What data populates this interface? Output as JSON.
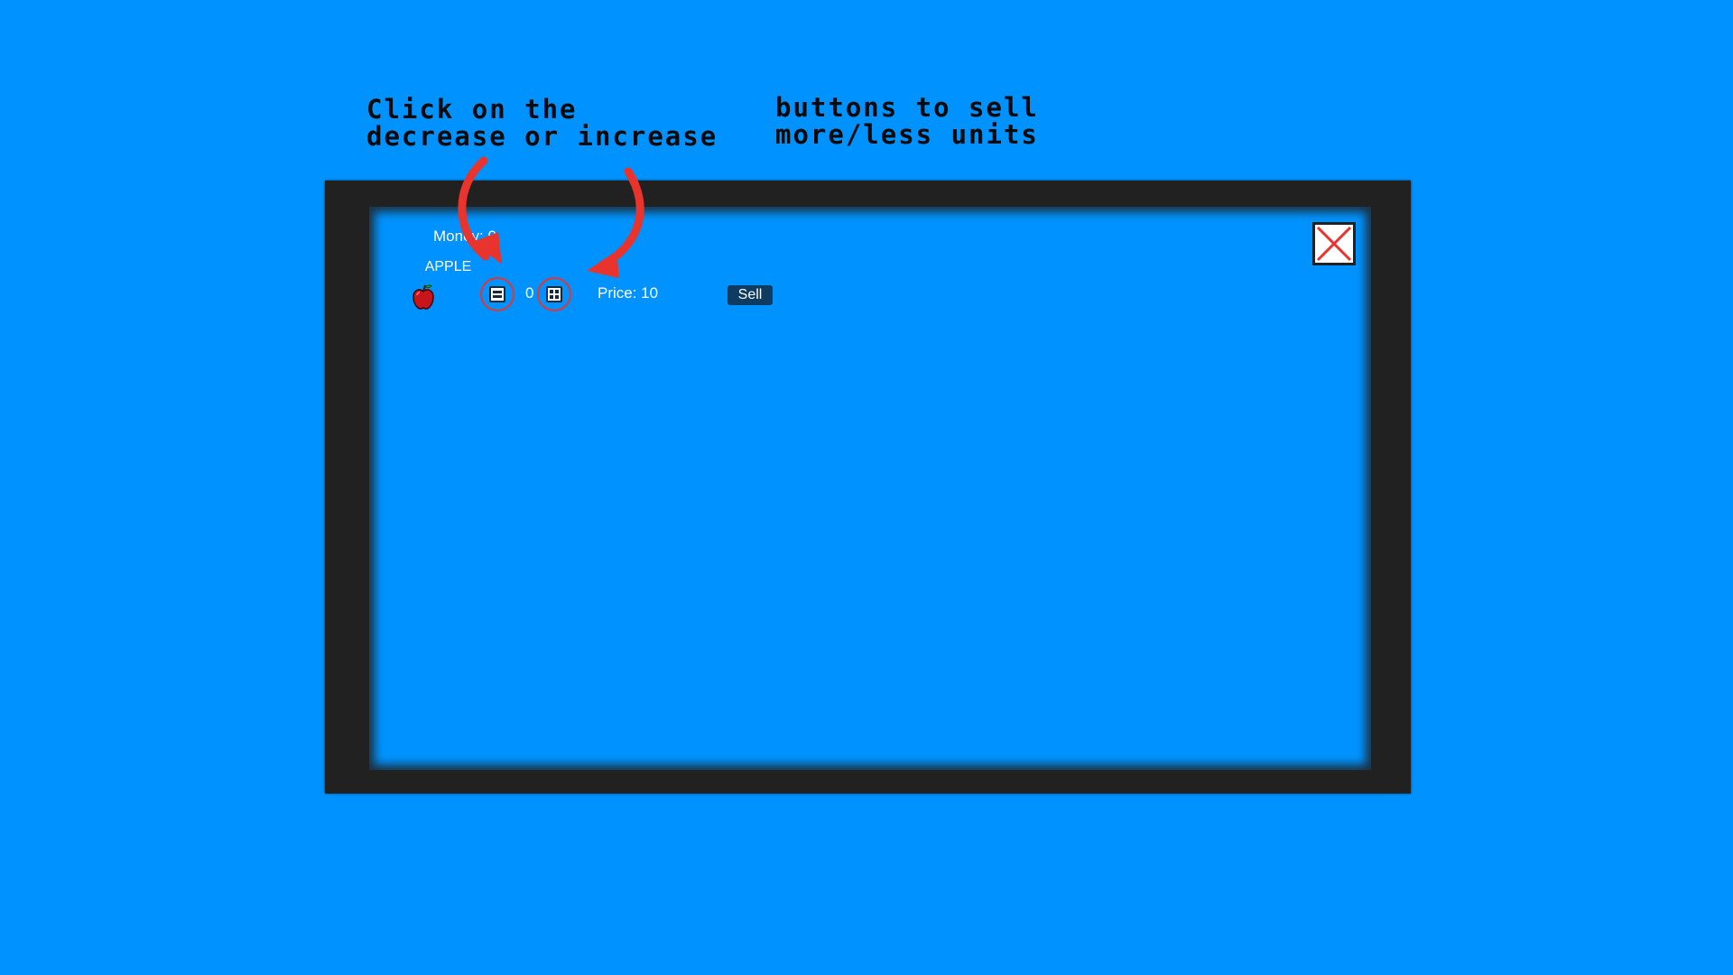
{
  "instructions": {
    "left_line1": "Click on the",
    "left_line2": "decrease or increase",
    "right_line1": "buttons to sell",
    "right_line2": "more/less units"
  },
  "shop": {
    "money_label": "Money: 0",
    "close_icon": "close-x-icon",
    "items": [
      {
        "name": "APPLE",
        "icon": "apple-icon",
        "quantity": "0",
        "price_label": "Price: 10",
        "sell_label": "Sell"
      }
    ]
  },
  "colors": {
    "background": "#0093ff",
    "frame": "#212121",
    "annotation_red": "#e8342c",
    "sell_button": "#0e3b62"
  }
}
